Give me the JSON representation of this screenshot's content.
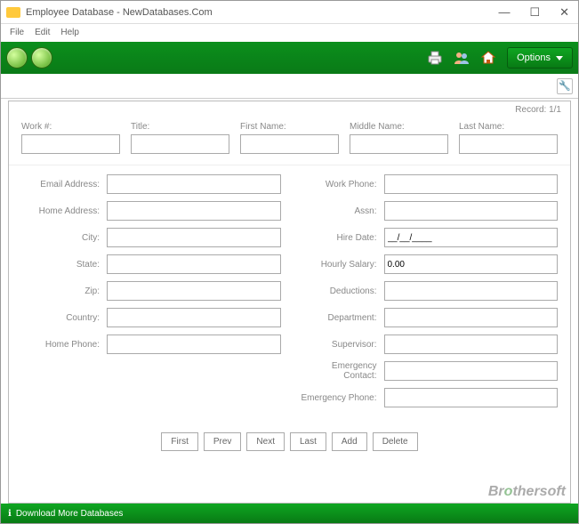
{
  "window": {
    "title": "Employee Database - NewDatabases.Com"
  },
  "menubar": {
    "file": "File",
    "edit": "Edit",
    "help": "Help"
  },
  "toolbar": {
    "options_label": "Options"
  },
  "record_info": "Record: 1/1",
  "top_fields": {
    "work_id": "Work #:",
    "title": "Title:",
    "first_name": "First Name:",
    "middle_name": "Middle Name:",
    "last_name": "Last Name:"
  },
  "left_fields": {
    "email_address": "Email Address:",
    "home_address": "Home Address:",
    "city": "City:",
    "state": "State:",
    "zip": "Zip:",
    "country": "Country:",
    "home_phone": "Home Phone:"
  },
  "right_fields": {
    "work_phone": "Work Phone:",
    "assn": "Assn:",
    "hire_date": "Hire Date:",
    "hourly_salary": "Hourly Salary:",
    "deductions": "Deductions:",
    "department": "Department:",
    "supervisor": "Supervisor:",
    "emergency_contact": "Emergency Contact:",
    "emergency_phone": "Emergency Phone:"
  },
  "values": {
    "hire_date": "__/__/____",
    "hourly_salary": "0.00"
  },
  "nav": {
    "first": "First",
    "prev": "Prev",
    "next": "Next",
    "last": "Last",
    "add": "Add",
    "delete": "Delete"
  },
  "status": {
    "download": "Download More Databases"
  },
  "brand": {
    "part1": "Br",
    "part2": "o",
    "part3": "thersoft"
  }
}
